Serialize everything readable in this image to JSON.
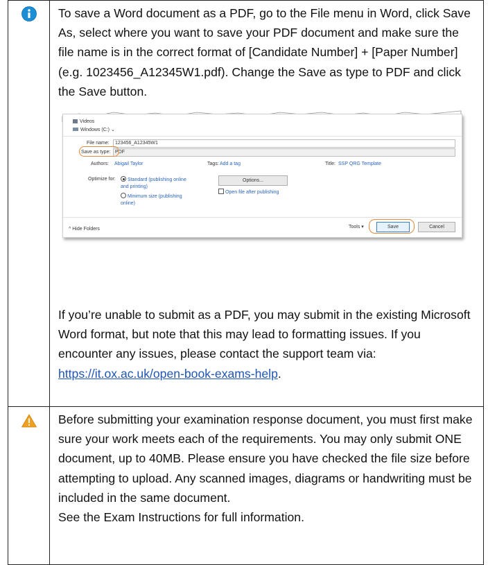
{
  "info_row": {
    "icon": "info-icon",
    "icon_color": "#1b8fd6",
    "paragraph1": "To save a Word document as a PDF, go to the File menu in Word, click Save As, select where you want to save your PDF document and make sure the file name is in the correct format of [Candidate Number] + [Paper Number] (e.g. 1023456_A12345W1.pdf). Change the Save as type to PDF and click the Save button.",
    "paragraph2_text": "If you’re unable to submit as a PDF, you may submit in the existing Microsoft Word format, but note that this may lead to formatting issues. If you encounter any issues, please contact the support team via: ",
    "support_link": "https://it.ox.ac.uk/open-book-exams-help",
    "paragraph2_end": "."
  },
  "dialog": {
    "nav_items": [
      "Videos",
      "Windows (C:)"
    ],
    "file_name_label": "File name:",
    "file_name_value": "123456_A12345W1",
    "save_type_label": "Save as type:",
    "save_type_value": "PDF",
    "authors_label": "Authors:",
    "authors_value": "Abigail Taylor",
    "tags_label": "Tags:",
    "tags_value": "Add a tag",
    "title_label": "Title:",
    "title_value": "SSP QRG Template",
    "optimize_label": "Optimize for:",
    "optimize_standard": "Standard (publishing online and printing)",
    "optimize_minimum": "Minimum size (publishing online)",
    "options_button": "Options...",
    "open_after_label": "Open file after publishing",
    "hide_folders": "Hide Folders",
    "tools_label": "Tools",
    "save_button": "Save",
    "cancel_button": "Cancel",
    "highlight_color": "#e3893b"
  },
  "warning_row": {
    "icon": "warning-icon",
    "icon_color": "#f0a020",
    "paragraph": "Before submitting your examination response document, you must first make sure your work meets each of the requirements.  You may only submit ONE document, up to 40MB. Please ensure you have checked the file size before attempting to upload. Any scanned images, diagrams or handwriting must be included in the same document.",
    "paragraph_last": "See the Exam Instructions for full information."
  }
}
